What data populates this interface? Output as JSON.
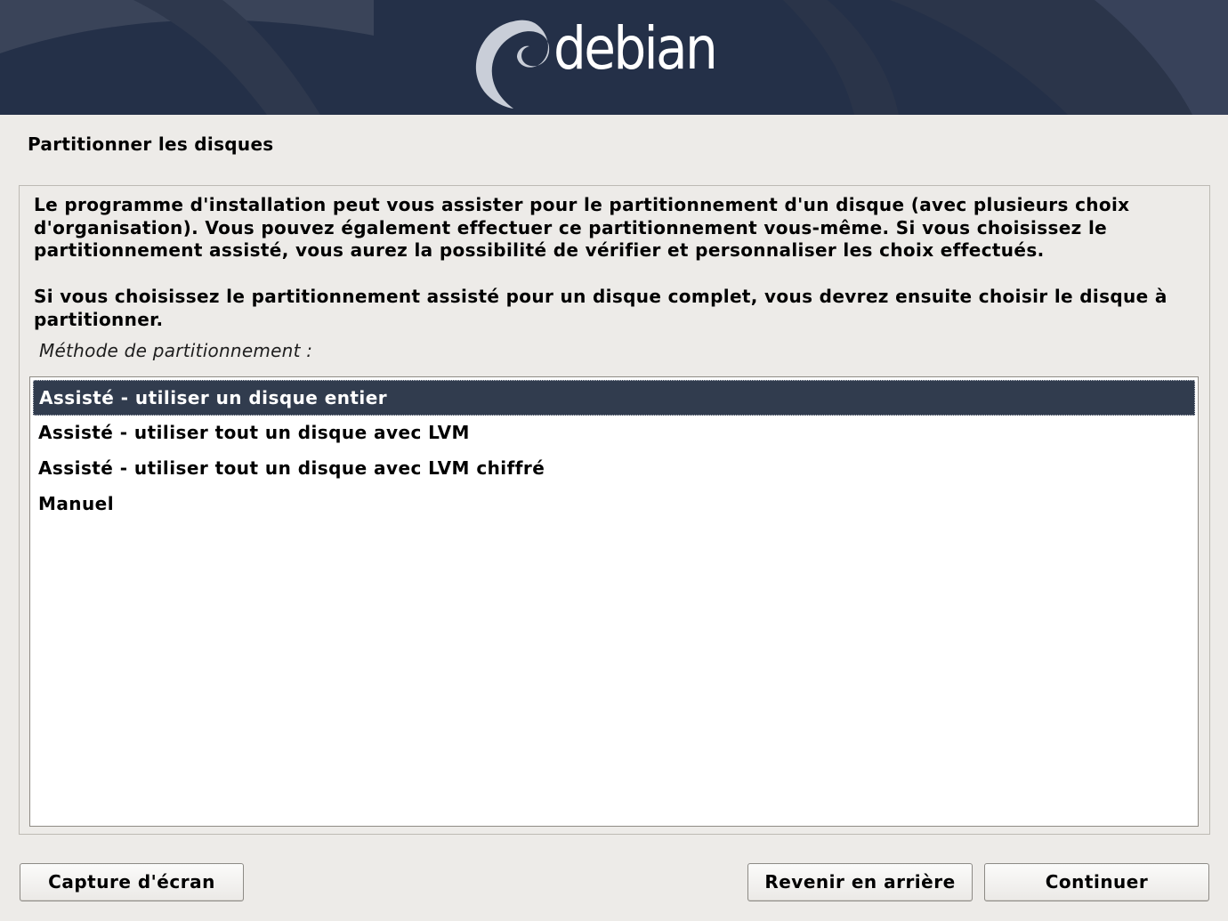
{
  "banner": {
    "logo_text": "debian",
    "logo_icon": "debian-swirl-icon"
  },
  "page_title": "Partitionner les disques",
  "description": {
    "paragraph1": "Le programme d'installation peut vous assister pour le partitionnement d'un disque (avec plusieurs choix d'organisation). Vous pouvez également effectuer ce partitionnement vous-même. Si vous choisissez le partitionnement assisté, vous aurez la possibilité de vérifier et personnaliser les choix effectués.",
    "paragraph2": "Si vous choisissez le partitionnement assisté pour un disque complet, vous devrez ensuite choisir le disque à partitionner."
  },
  "method_label": "Méthode de partitionnement :",
  "methods": [
    {
      "label": "Assisté - utiliser un disque entier",
      "selected": true
    },
    {
      "label": "Assisté - utiliser tout un disque avec LVM",
      "selected": false
    },
    {
      "label": "Assisté - utiliser tout un disque avec LVM chiffré",
      "selected": false
    },
    {
      "label": "Manuel",
      "selected": false
    }
  ],
  "buttons": {
    "screenshot": "Capture d'écran",
    "back": "Revenir en arrière",
    "continue": "Continuer"
  },
  "colors": {
    "banner_bg": "#243048",
    "selection_bg": "#313c4e",
    "window_bg": "#edebe8"
  }
}
